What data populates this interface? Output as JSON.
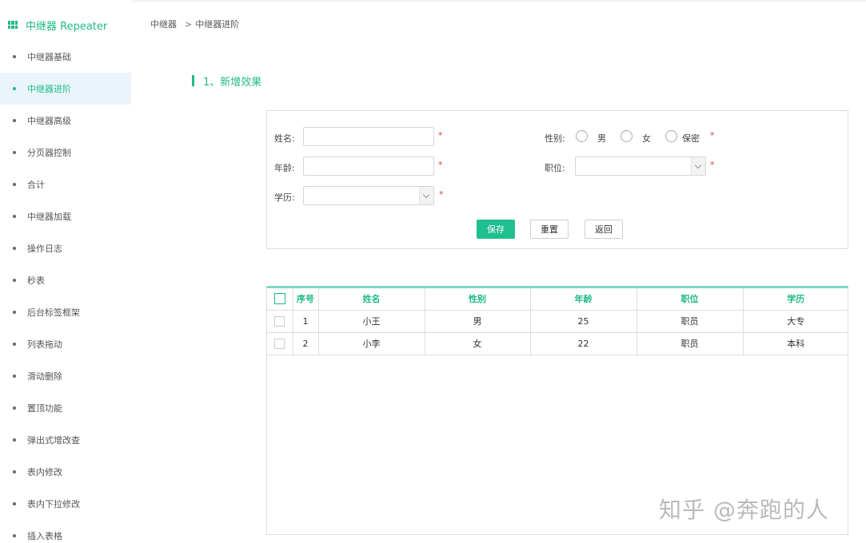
{
  "sidebar": {
    "title": "中继器 Repeater",
    "items": [
      {
        "label": "中继器基础",
        "active": false
      },
      {
        "label": "中继器进阶",
        "active": true
      },
      {
        "label": "中继器高级",
        "active": false
      },
      {
        "label": "分页器控制",
        "active": false
      },
      {
        "label": "合计",
        "active": false
      },
      {
        "label": "中继器加载",
        "active": false
      },
      {
        "label": "操作日志",
        "active": false
      },
      {
        "label": "秒表",
        "active": false
      },
      {
        "label": "后台标签框架",
        "active": false
      },
      {
        "label": "列表拖动",
        "active": false
      },
      {
        "label": "滑动删除",
        "active": false
      },
      {
        "label": "置顶功能",
        "active": false
      },
      {
        "label": "弹出式增改查",
        "active": false
      },
      {
        "label": "表内修改",
        "active": false
      },
      {
        "label": "表内下拉修改",
        "active": false
      },
      {
        "label": "插入表格",
        "active": false
      }
    ]
  },
  "breadcrumb": {
    "root": "中继器",
    "separator": ">",
    "current": "中继器进阶"
  },
  "section_title": "1、新增效果",
  "form": {
    "name_label": "姓名:",
    "age_label": "年龄:",
    "education_label": "学历:",
    "gender_label": "性别:",
    "position_label": "职位:",
    "required_mark": "*",
    "gender_options": [
      "男",
      "女",
      "保密"
    ],
    "name_value": "",
    "age_value": "",
    "education_value": "",
    "position_value": "",
    "save_label": "保存",
    "reset_label": "重置",
    "back_label": "返回"
  },
  "table": {
    "headers": [
      "序号",
      "姓名",
      "性别",
      "年龄",
      "职位",
      "学历"
    ],
    "rows": [
      {
        "index": "1",
        "name": "小王",
        "gender": "男",
        "age": "25",
        "position": "职员",
        "education": "大专"
      },
      {
        "index": "2",
        "name": "小李",
        "gender": "女",
        "age": "22",
        "position": "职员",
        "education": "本科"
      }
    ]
  },
  "watermark": "知乎 @奔跑的人",
  "colors": {
    "accent": "#1fb987",
    "primary_button": "#1fbf8f",
    "active_item_bg": "#e9f5fb",
    "required": "#e4393c"
  },
  "icons": {
    "sidebar_title_icon": "table-grid-icon"
  }
}
